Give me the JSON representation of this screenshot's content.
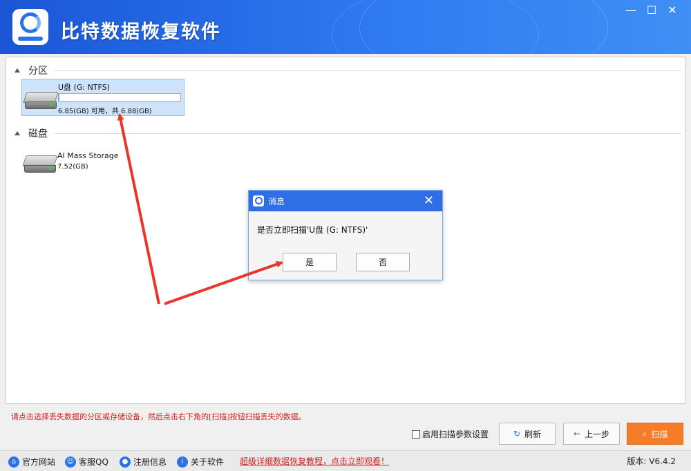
{
  "app": {
    "title": "比特数据恢复软件"
  },
  "window_controls": {
    "minimize": "—",
    "maximize": "☐",
    "close": "✕"
  },
  "sections": {
    "partition": {
      "label": "分区"
    },
    "disk": {
      "label": "磁盘"
    }
  },
  "partitions": [
    {
      "name": "U盘 (G: NTFS)",
      "capacity": "6.85(GB) 可用，共 6.88(GB)",
      "used_fraction": 0.004
    }
  ],
  "disks": [
    {
      "name": "AI Mass Storage",
      "size": "7.52(GB)"
    }
  ],
  "dialog": {
    "title": "消息",
    "message": "是否立即扫描'U盘 (G: NTFS)'",
    "yes_label": "是",
    "no_label": "否",
    "close": "✕"
  },
  "hint": "请点击选择丢失数据的分区或存储设备，然后点击右下角的[扫描]按钮扫描丢失的数据。",
  "options": {
    "scan_params_label": "启用扫描参数设置"
  },
  "buttons": {
    "refresh": "刷新",
    "back": "上一步",
    "scan": "扫描"
  },
  "statusbar": {
    "website": "官方网站",
    "qq": "客服QQ",
    "register": "注册信息",
    "about": "关于软件",
    "tutorial": "超级详细数据恢复教程，点击立即观看！",
    "version": "版本: V6.4.2"
  },
  "colors": {
    "accent": "#2f6fe6",
    "scan_button": "#f57d2a",
    "hint_red": "#d42020",
    "arrow_red": "#e8362a"
  }
}
